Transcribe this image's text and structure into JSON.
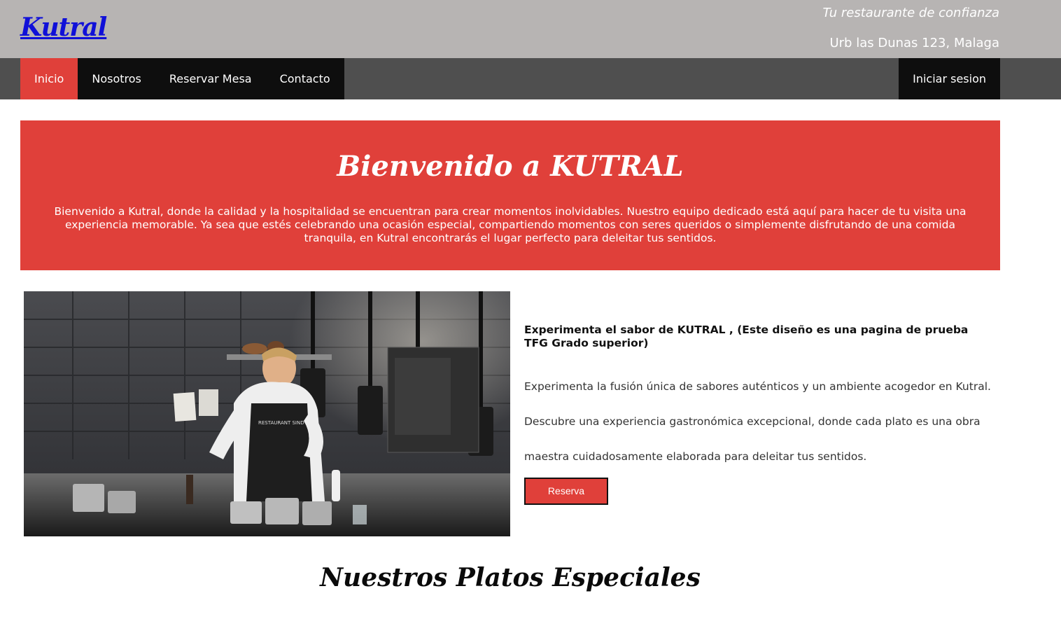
{
  "header": {
    "brand": "Kutral",
    "tagline": "Tu restaurante de confianza",
    "address": "Urb las Dunas 123, Malaga"
  },
  "nav": {
    "items": [
      {
        "label": "Inicio",
        "active": true
      },
      {
        "label": "Nosotros",
        "active": false
      },
      {
        "label": "Reservar Mesa",
        "active": false
      },
      {
        "label": "Contacto",
        "active": false
      }
    ],
    "login": "Iniciar sesion"
  },
  "hero": {
    "title": "Bienvenido a KUTRAL",
    "text": "Bienvenido a Kutral, donde la calidad y la hospitalidad se encuentran para crear momentos inolvidables. Nuestro equipo dedicado está aquí para hacer de tu visita una experiencia memorable. Ya sea que estés celebrando una ocasión especial, compartiendo momentos con seres queridos o simplemente disfrutando de una comida tranquila, en Kutral encontrarás el lugar perfecto para deleitar tus sentidos."
  },
  "intro": {
    "heading": "Experimenta el sabor de KUTRAL , (Este diseño es una pagina de prueba TFG Grado superior)",
    "body": "Experimenta la fusión única de sabores auténticos y un ambiente acogedor en Kutral. Descubre una experiencia gastronómica excepcional, donde cada plato es una obra maestra cuidadosamente elaborada para deleitar tus sentidos.",
    "button": "Reserva",
    "image_label": "RESTAURANT SIND"
  },
  "specials": {
    "title": "Nuestros Platos Especiales"
  },
  "colors": {
    "accent": "#e0403a",
    "header_bg": "#b7b4b3",
    "nav_bg": "#4f4f4f",
    "nav_item_bg": "#0e0e0e",
    "brand_link": "#1010d8"
  }
}
